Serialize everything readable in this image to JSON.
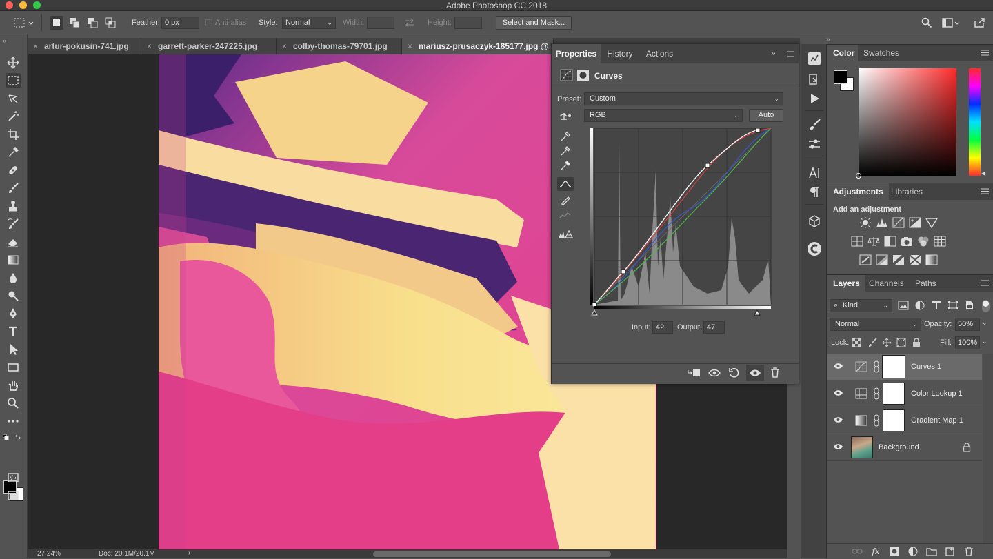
{
  "app": {
    "title": "Adobe Photoshop CC 2018"
  },
  "options": {
    "feather_label": "Feather:",
    "feather_value": "0 px",
    "antialias_label": "Anti-alias",
    "style_label": "Style:",
    "style_value": "Normal",
    "width_label": "Width:",
    "height_label": "Height:",
    "select_mask_label": "Select and Mask..."
  },
  "tabs": [
    {
      "label": "artur-pokusin-741.jpg"
    },
    {
      "label": "garrett-parker-247225.jpg"
    },
    {
      "label": "colby-thomas-79701.jpg"
    },
    {
      "label": "mariusz-prusaczyk-185177.jpg @ 2"
    }
  ],
  "status": {
    "zoom": "27.24%",
    "doc": "Doc: 20.1M/20.1M"
  },
  "properties": {
    "tabs": [
      "Properties",
      "History",
      "Actions"
    ],
    "title": "Curves",
    "preset_label": "Preset:",
    "preset_value": "Custom",
    "channel_value": "RGB",
    "auto_label": "Auto",
    "input_label": "Input:",
    "input_value": "42",
    "output_label": "Output:",
    "output_value": "47"
  },
  "color_panel": {
    "tabs": [
      "Color",
      "Swatches"
    ]
  },
  "adjustments_panel": {
    "tabs": [
      "Adjustments",
      "Libraries"
    ],
    "hint": "Add an adjustment"
  },
  "layers_panel": {
    "tabs": [
      "Layers",
      "Channels",
      "Paths"
    ],
    "kind_label": "Kind",
    "blend_mode": "Normal",
    "opacity_label": "Opacity:",
    "opacity_value": "50%",
    "lock_label": "Lock:",
    "fill_label": "Fill:",
    "fill_value": "100%",
    "layers": [
      {
        "name": "Curves 1"
      },
      {
        "name": "Color Lookup 1"
      },
      {
        "name": "Gradient Map 1"
      },
      {
        "name": "Background"
      }
    ]
  },
  "colors": {
    "accent": "#ffffff",
    "panel_bg": "#535353",
    "dark_bg": "#282828",
    "selected_layer": "#6a6a6a"
  }
}
